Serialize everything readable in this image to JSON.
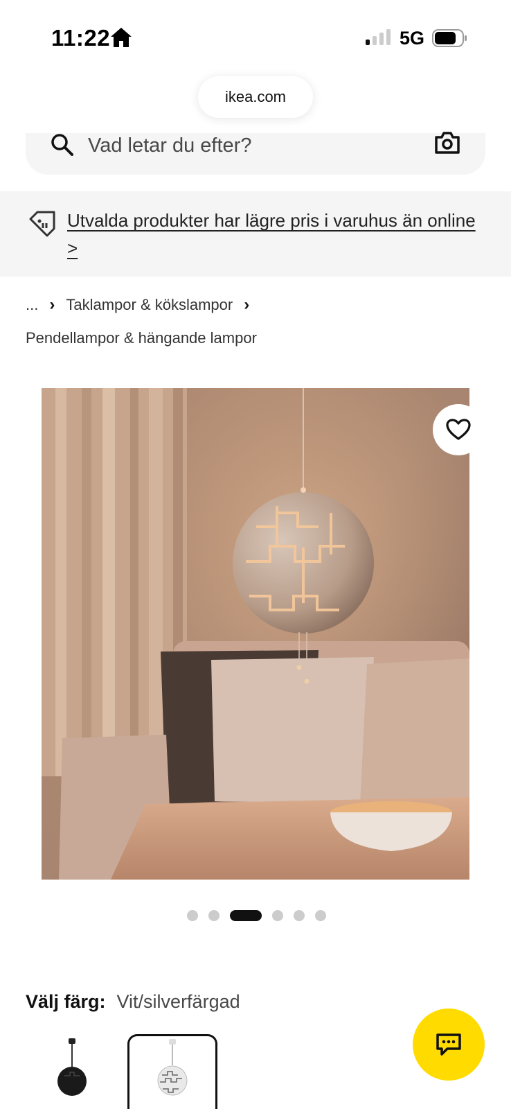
{
  "status_bar": {
    "time": "11:22",
    "network": "5G"
  },
  "browser": {
    "url": "ikea.com"
  },
  "search": {
    "placeholder": "Vad letar du efter?"
  },
  "promo": {
    "text": "Utvalda produkter har lägre pris i varuhus än online >"
  },
  "breadcrumb": {
    "ellipsis": "...",
    "level1": "Taklampor & kökslampor",
    "level2": "Pendellampor & hängande lampor"
  },
  "carousel": {
    "total": 6,
    "active_index": 3
  },
  "color": {
    "label": "Välj färg:",
    "value": "Vit/silverfärgad",
    "options": [
      "black",
      "white-silver"
    ],
    "selected": "white-silver"
  },
  "colors": {
    "accent_yellow": "#ffdb00",
    "banner_bg": "#f5f5f5"
  },
  "icons": {
    "home": "home-icon",
    "search": "search-icon",
    "camera": "camera-icon",
    "tag": "price-tag-icon",
    "favorite": "heart-icon",
    "chat": "chat-icon"
  }
}
